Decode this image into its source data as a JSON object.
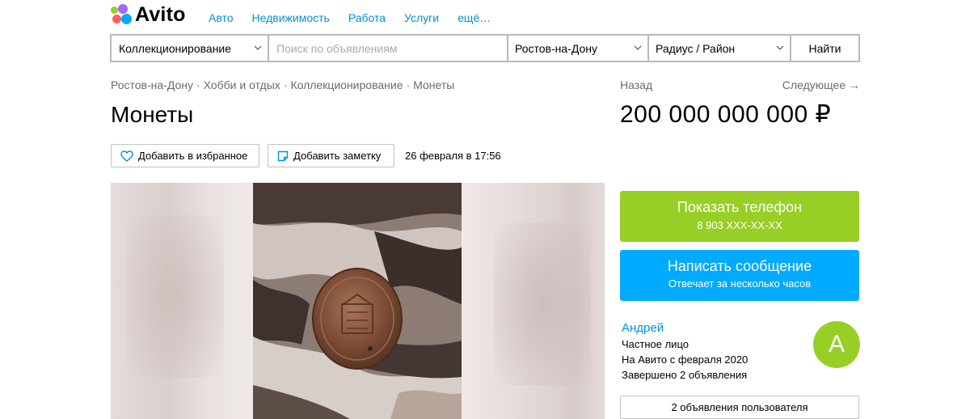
{
  "header": {
    "logo_text": "Avito",
    "nav": [
      "Авто",
      "Недвижимость",
      "Работа",
      "Услуги",
      "ещё…"
    ]
  },
  "search": {
    "category": "Коллекционирование",
    "placeholder": "Поиск по объявлениям",
    "query": "",
    "city": "Ростов-на-Дону",
    "radius": "Радиус / Район",
    "submit_label": "Найти"
  },
  "breadcrumbs": [
    "Ростов-на-Дону",
    "Хобби и отдых",
    "Коллекционирование",
    "Монеты"
  ],
  "pager": {
    "back": "Назад",
    "next": "Следующее →"
  },
  "listing": {
    "title": "Монеты",
    "price": "200 000 000 000 ₽",
    "favorite_label": "Добавить в избранное",
    "note_label": "Добавить заметку",
    "date": "26 февраля в 17:56"
  },
  "contact": {
    "phone_label": "Показать телефон",
    "phone_masked": "8 903 XXX-XX-XX",
    "message_label": "Написать сообщение",
    "message_sub": "Отвечает за несколько часов"
  },
  "seller": {
    "name": "Андрей",
    "type": "Частное лицо",
    "since": "На Авито с февраля 2020",
    "completed": "Завершено 2 объявления",
    "avatar_letter": "А",
    "ads_button": "2 объявления пользователя"
  },
  "colors": {
    "accent_blue": "#0091d9",
    "green": "#97cf26",
    "message_blue": "#00aaff"
  }
}
